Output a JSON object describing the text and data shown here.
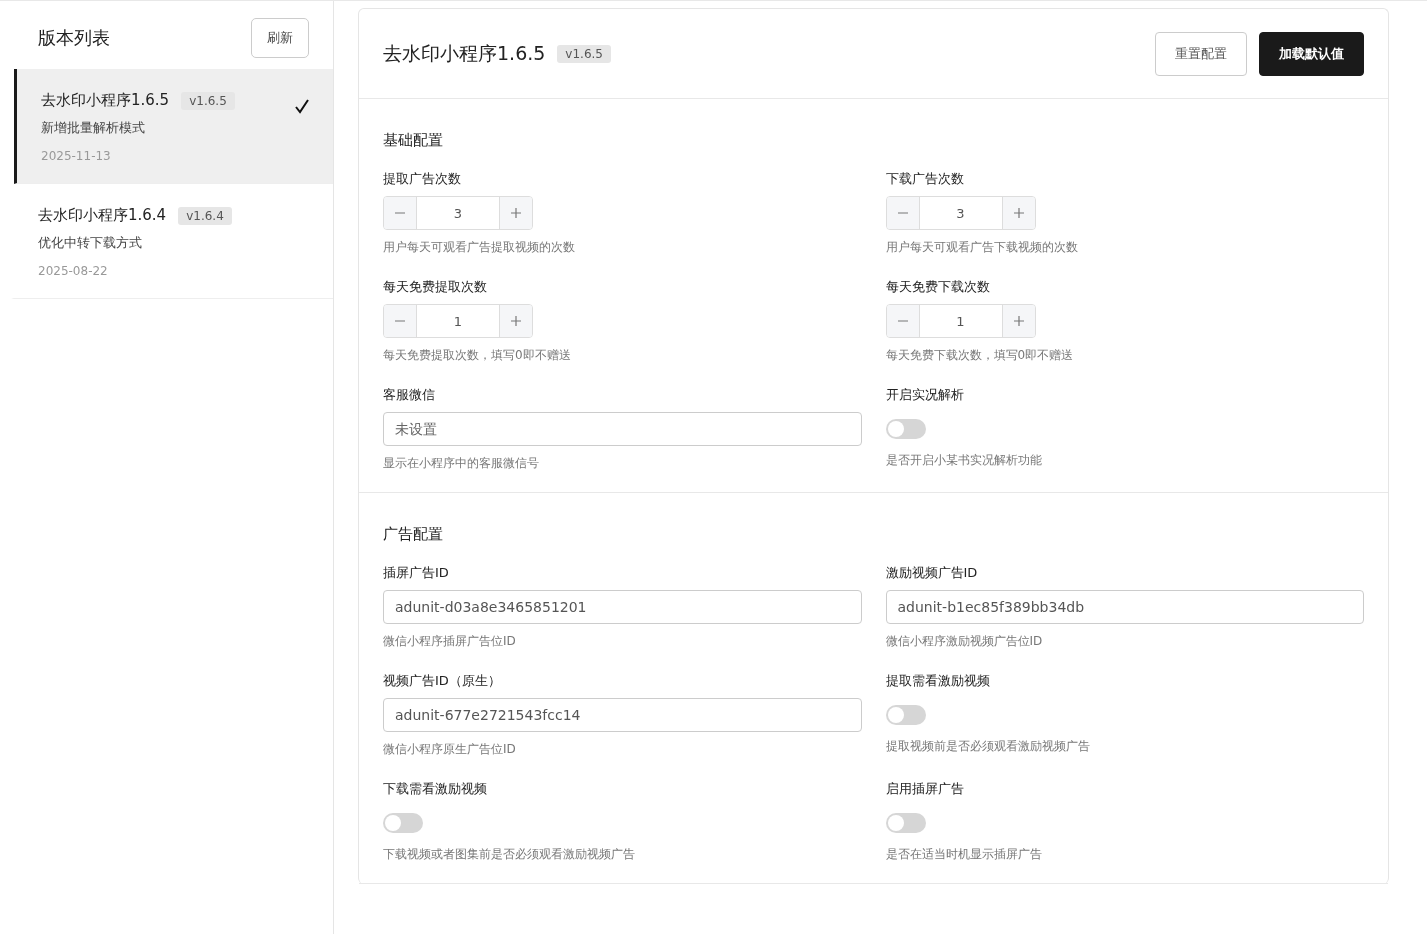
{
  "sidebar": {
    "title": "版本列表",
    "refresh_button": "刷新",
    "versions": [
      {
        "name": "去水印小程序1.6.5",
        "tag": "v1.6.5",
        "note": "新增批量解析模式",
        "date": "2025-11-13",
        "selected": true
      },
      {
        "name": "去水印小程序1.6.4",
        "tag": "v1.6.4",
        "note": "优化中转下载方式",
        "date": "2025-08-22",
        "selected": false
      }
    ]
  },
  "header": {
    "title": "去水印小程序1.6.5",
    "tag": "v1.6.5",
    "buttons": [
      {
        "label": "重置配置",
        "kind": "outline"
      },
      {
        "label": "加载默认值",
        "kind": "primary"
      }
    ]
  },
  "sections": [
    {
      "title": "基础配置",
      "fields": [
        {
          "kind": "stepper",
          "label": "提取广告次数",
          "value": "3",
          "hint": "用户每天可观看广告提取视频的次数"
        },
        {
          "kind": "stepper",
          "label": "下载广告次数",
          "value": "3",
          "hint": "用户每天可观看广告下载视频的次数"
        },
        {
          "kind": "stepper",
          "label": "每天免费提取次数",
          "value": "1",
          "hint": "每天免费提取次数，填写0即不赠送"
        },
        {
          "kind": "stepper",
          "label": "每天免费下载次数",
          "value": "1",
          "hint": "每天免费下载次数，填写0即不赠送"
        },
        {
          "kind": "text",
          "label": "客服微信",
          "placeholder": "未设置",
          "hint": "显示在小程序中的客服微信号"
        },
        {
          "kind": "switch",
          "label": "开启实况解析",
          "on": false,
          "hint": "是否开启小某书实况解析功能"
        }
      ]
    },
    {
      "title": "广告配置",
      "fields": [
        {
          "kind": "text",
          "label": "插屏广告ID",
          "value": "adunit-d03a8e3465851201",
          "hint": "微信小程序插屏广告位ID"
        },
        {
          "kind": "text",
          "label": "激励视频广告ID",
          "value": "adunit-b1ec85f389bb34db",
          "hint": "微信小程序激励视频广告位ID"
        },
        {
          "kind": "text",
          "label": "视频广告ID（原生）",
          "value": "adunit-677e2721543fcc14",
          "hint": "微信小程序原生广告位ID"
        },
        {
          "kind": "switch",
          "label": "提取需看激励视频",
          "on": false,
          "hint": "提取视频前是否必须观看激励视频广告"
        },
        {
          "kind": "switch",
          "label": "下载需看激励视频",
          "on": false,
          "hint": "下载视频或者图集前是否必须观看激励视频广告"
        },
        {
          "kind": "switch",
          "label": "启用插屏广告",
          "on": false,
          "hint": "是否在适当时机显示插屏广告"
        }
      ]
    }
  ]
}
